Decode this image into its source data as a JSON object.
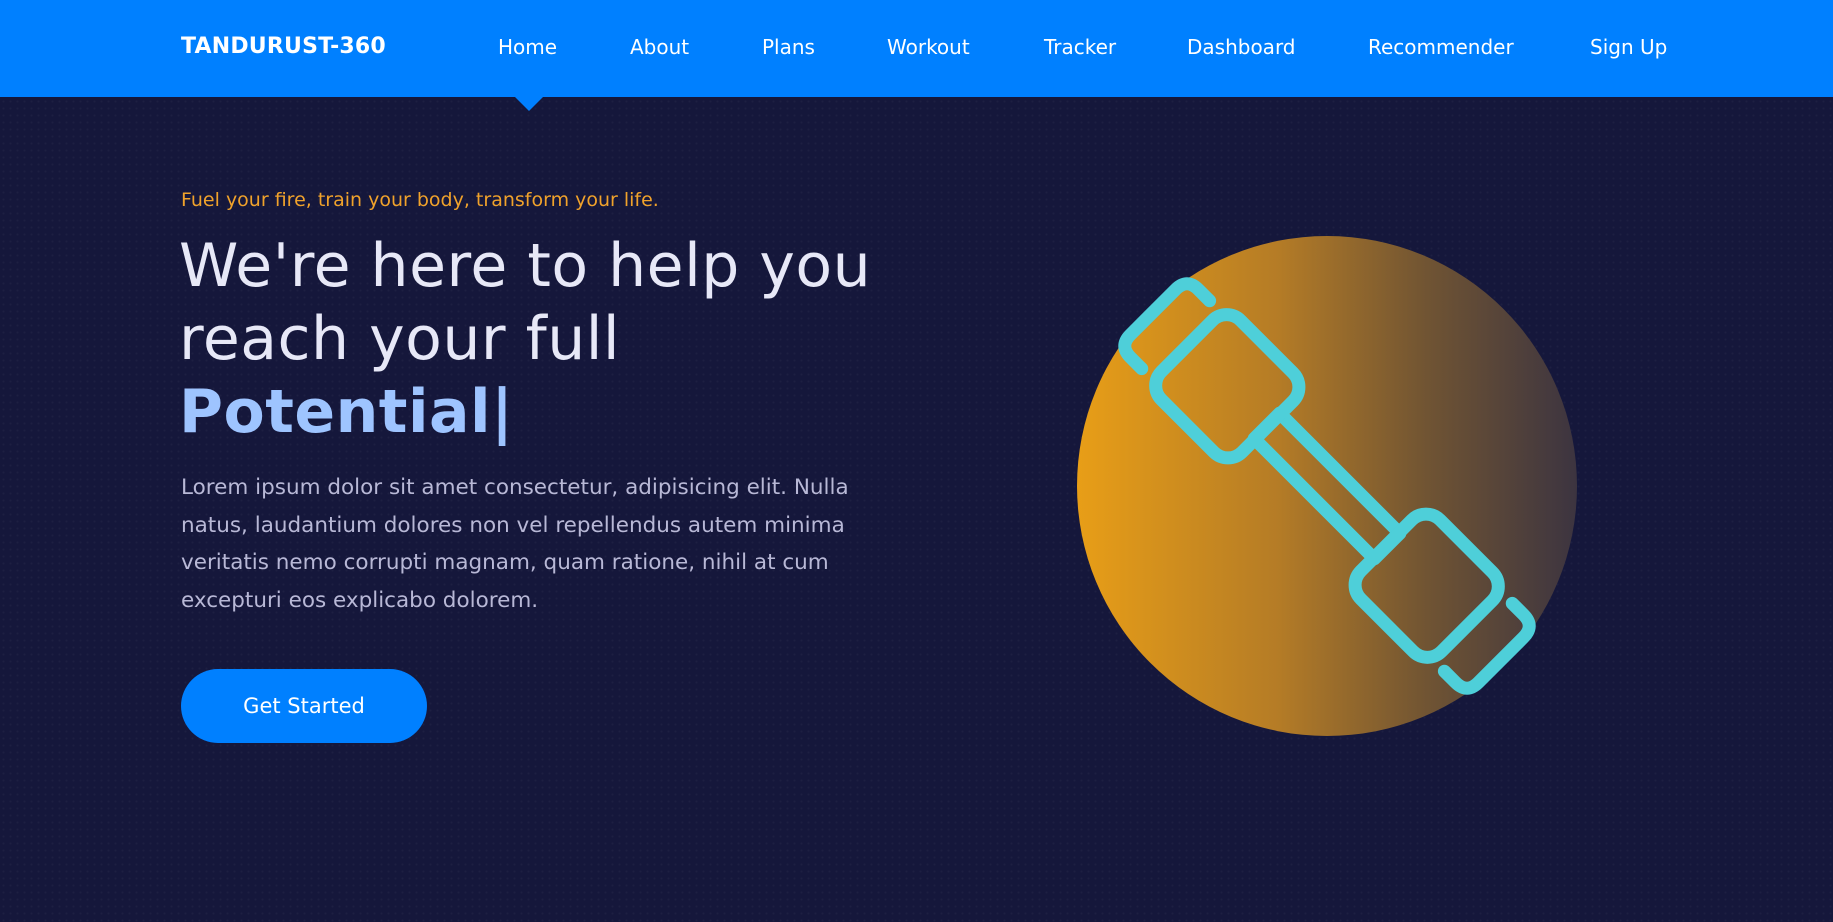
{
  "brand": {
    "logo": "TANDURUST-360"
  },
  "nav": {
    "items": [
      {
        "label": "Home"
      },
      {
        "label": "About"
      },
      {
        "label": "Plans"
      },
      {
        "label": "Workout"
      },
      {
        "label": "Tracker"
      },
      {
        "label": "Dashboard"
      },
      {
        "label": "Recommender"
      },
      {
        "label": "Sign Up"
      }
    ],
    "active": "Home"
  },
  "hero": {
    "tagline": "Fuel your fire, train your body, transform your life.",
    "headline_line1": "We're here to help you",
    "headline_line2": "reach your full",
    "headline_accent": "Potential",
    "cursor": "|",
    "description": "Lorem ipsum dolor sit amet consectetur, adipisicing elit. Nulla natus, laudantium dolores non vel repellendus autem minima veritatis nemo corrupti magnam, quam ratione, nihil at cum excepturi eos explicabo dolorem.",
    "cta_label": "Get Started",
    "icon": "dumbbell-icon"
  },
  "colors": {
    "navbar": "#0080ff",
    "background": "#15173b",
    "tagline": "#f0a22b",
    "accent_text": "#9ec4ff",
    "button": "#0080ff",
    "icon_stroke": "#4ecfd9",
    "circle_gradient_start": "#e89e17",
    "circle_gradient_end": "#3c3440"
  }
}
